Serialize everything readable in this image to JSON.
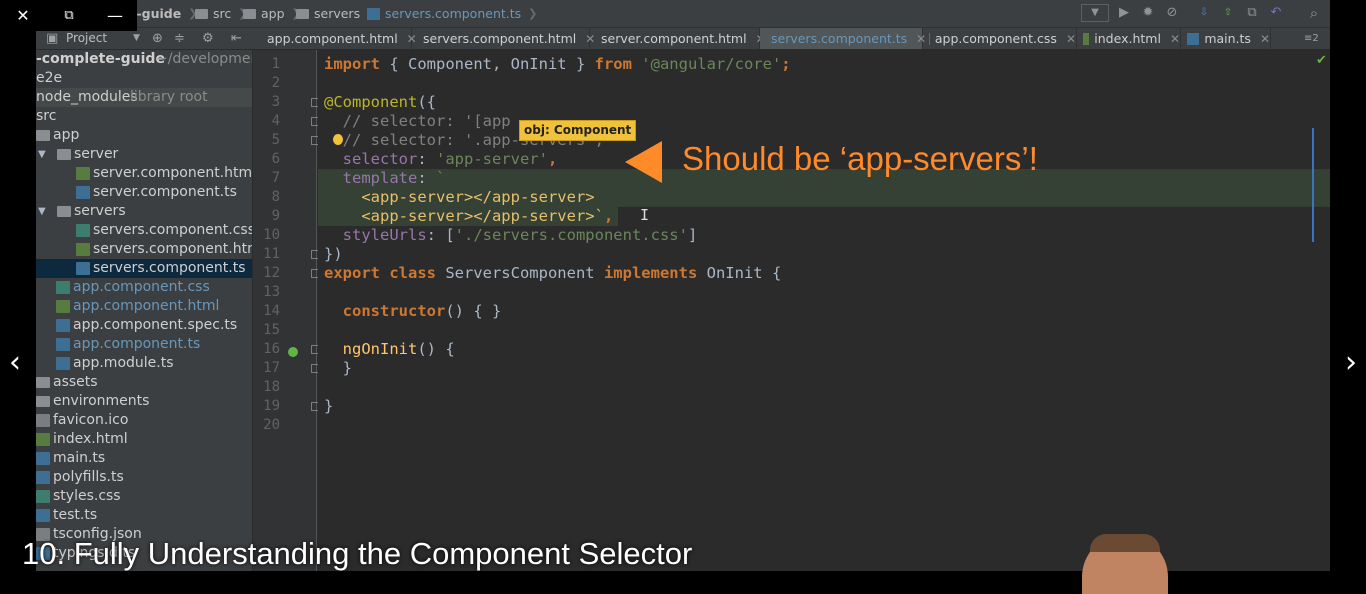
{
  "window_controls": {
    "close": "✕",
    "restore": "⧉",
    "minimize": "—"
  },
  "breadcrumb": [
    {
      "label": "e-guide",
      "icon": "none"
    },
    {
      "label": "src",
      "icon": "folder-icon"
    },
    {
      "label": "app",
      "icon": "folder-icon"
    },
    {
      "label": "servers",
      "icon": "folder-icon"
    },
    {
      "label": "servers.component.ts",
      "icon": "ts-file-icon"
    }
  ],
  "project_panel": {
    "label": "Project"
  },
  "tabs": [
    {
      "label": "app.component.html",
      "type": "html"
    },
    {
      "label": "servers.component.html",
      "type": "html"
    },
    {
      "label": "server.component.html",
      "type": "html"
    },
    {
      "label": "servers.component.ts",
      "type": "ts",
      "active": true
    },
    {
      "label": "app.component.css",
      "type": "css"
    },
    {
      "label": "index.html",
      "type": "html"
    },
    {
      "label": "main.ts",
      "type": "ts"
    }
  ],
  "tabs_overflow": "≡2",
  "tree": [
    {
      "label": "-complete-guide",
      "extra": "~/development/",
      "bold": true
    },
    {
      "label": "e2e"
    },
    {
      "label": "node_modules",
      "extra": "library root"
    },
    {
      "label": "src"
    },
    {
      "label": "app"
    },
    {
      "label": "server"
    },
    {
      "label": "server.component.html"
    },
    {
      "label": "server.component.ts"
    },
    {
      "label": "servers"
    },
    {
      "label": "servers.component.css"
    },
    {
      "label": "servers.component.html"
    },
    {
      "label": "servers.component.ts"
    },
    {
      "label": "app.component.css"
    },
    {
      "label": "app.component.html"
    },
    {
      "label": "app.component.spec.ts"
    },
    {
      "label": "app.component.ts"
    },
    {
      "label": "app.module.ts"
    },
    {
      "label": "assets"
    },
    {
      "label": "environments"
    },
    {
      "label": "favicon.ico"
    },
    {
      "label": "index.html"
    },
    {
      "label": "main.ts"
    },
    {
      "label": "polyfills.ts"
    },
    {
      "label": "styles.css"
    },
    {
      "label": "test.ts"
    },
    {
      "label": "tsconfig.json"
    },
    {
      "label": "typings.d.ts"
    }
  ],
  "line_numbers": [
    "1",
    "2",
    "3",
    "4",
    "5",
    "6",
    "7",
    "8",
    "9",
    "10",
    "11",
    "12",
    "13",
    "14",
    "15",
    "16",
    "17",
    "18",
    "19",
    "20"
  ],
  "code": {
    "l1": {
      "a": "import",
      "b": " { Component, OnInit } ",
      "c": "from",
      "d": " '@angular/core'",
      "e": ";"
    },
    "l3": {
      "a": "@Component",
      "b": "({"
    },
    "l4": {
      "a": "  // selector: '[app"
    },
    "l5": {
      "a": "  // selector: '.app-servers',"
    },
    "l6": {
      "a": "  selector",
      "b": ": ",
      "c": "'app-server'",
      "d": ","
    },
    "l7": {
      "a": "  template",
      "b": ": ",
      "c": "`"
    },
    "l8": {
      "a": "    <app-server></app-server>"
    },
    "l9": {
      "a": "    <app-server></app-server>`",
      "b": ","
    },
    "l10": {
      "a": "  styleUrls",
      "b": ": [",
      "c": "'./servers.component.css'",
      "d": "]"
    },
    "l11": {
      "a": "})"
    },
    "l12": {
      "a": "export class",
      "b": " ServersComponent ",
      "c": "implements",
      "d": " OnInit {"
    },
    "l14": {
      "a": "  constructor",
      "b": "() { }"
    },
    "l16": {
      "a": "  ngOnInit",
      "b": "() {"
    },
    "l17": {
      "a": "  }"
    },
    "l19": {
      "a": "}"
    }
  },
  "tooltip": "obj: Component",
  "callout": "Should be ‘app-servers’!",
  "video_title": "10. Fully Understanding the Component Selector",
  "colors": {
    "accent": "#ff8a2a",
    "tooltip": "#f0c23c",
    "active_tab_text": "#6897bb"
  }
}
